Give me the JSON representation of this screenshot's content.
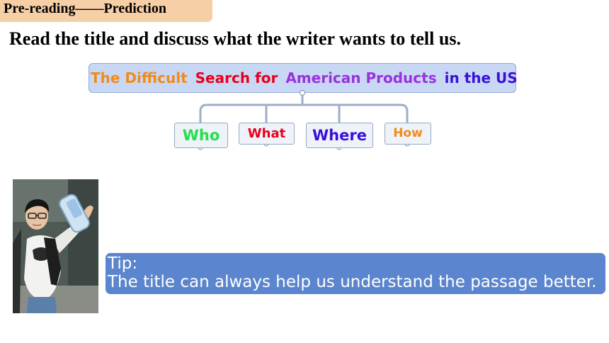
{
  "header": {
    "tag_label": "Pre-reading——Prediction",
    "tag_color": "#f7cfa7",
    "instruction": "Read the title and discuss what the writer wants to tell us."
  },
  "mindmap": {
    "title_words": [
      {
        "text": "The Difficult",
        "color": "#f28a1a"
      },
      {
        "text": "Search for",
        "color": "#e8001c"
      },
      {
        "text": "American Products",
        "color": "#9b30e0"
      },
      {
        "text": "in the US",
        "color": "#3a10d8"
      }
    ],
    "questions": [
      {
        "text": "Who",
        "color": "#22e04a"
      },
      {
        "text": "What",
        "color": "#e8001c"
      },
      {
        "text": "Where",
        "color": "#3a10d8"
      },
      {
        "text": "How",
        "color": "#f28a1a"
      }
    ]
  },
  "tip": {
    "heading": "Tip:",
    "text": "The title can always help us understand the passage better.",
    "background": "#5b85ce"
  }
}
